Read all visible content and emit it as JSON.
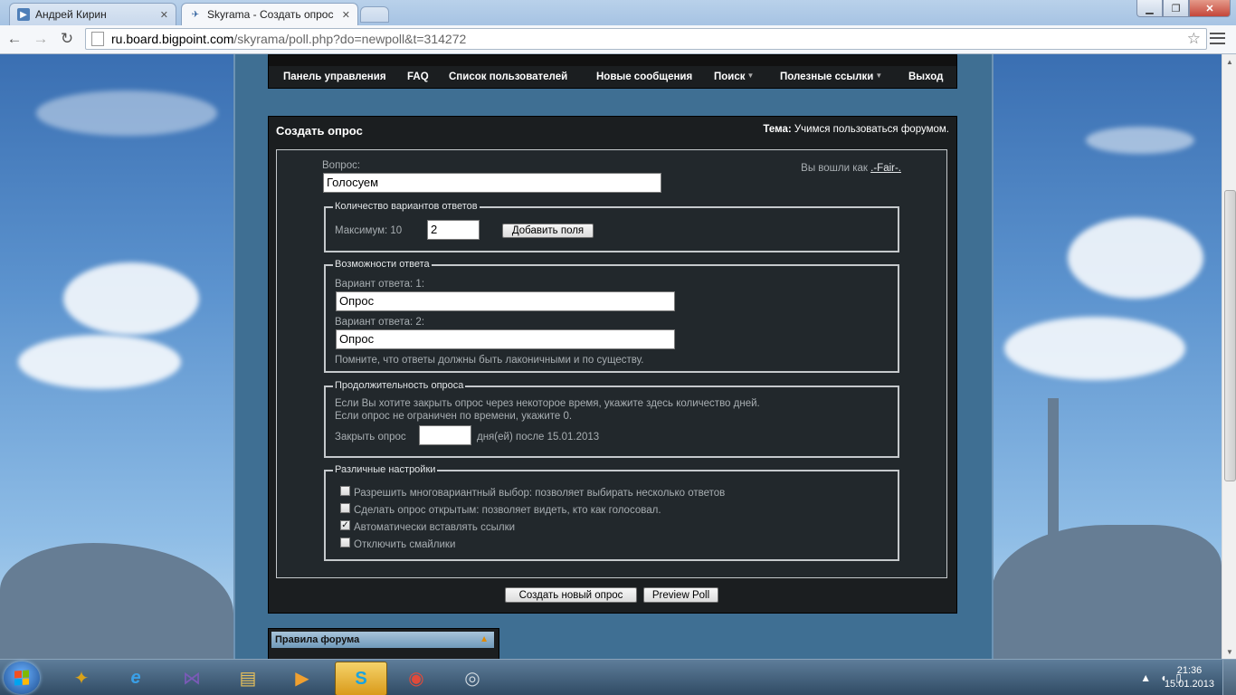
{
  "browser": {
    "tabs": [
      {
        "label": "Андрей Кирин"
      },
      {
        "label": "Skyrama - Создать опрос"
      }
    ],
    "url_host": "ru.board.bigpoint.com",
    "url_path": "/skyrama/poll.php?do=newpoll&t=314272"
  },
  "forum_nav": {
    "items": [
      {
        "label": "Панель управления"
      },
      {
        "label": "FAQ"
      },
      {
        "label": "Список пользователей"
      },
      {
        "label": "Новые сообщения"
      },
      {
        "label": "Поиск"
      },
      {
        "label": "Полезные ссылки"
      },
      {
        "label": "Выход"
      }
    ]
  },
  "poll_form": {
    "title": "Создать опрос",
    "topic_label": "Тема:",
    "topic_value": "Учимся пользоваться форумом.",
    "logged_in_label": "Вы вошли как",
    "username": ".-Fair-.",
    "question_label": "Вопрос:",
    "question_value": "Голосуем",
    "count_section": {
      "legend": "Количество вариантов ответов",
      "max_label": "Максимум: 10",
      "count_value": "2",
      "add_fields_label": "Добавить поля"
    },
    "options_section": {
      "legend": "Возможности ответа",
      "options": [
        {
          "label": "Вариант ответа: 1:",
          "value": "Опрос"
        },
        {
          "label": "Вариант ответа: 2:",
          "value": "Опрос"
        }
      ],
      "note": "Помните, что ответы должны быть лаконичными и по существу."
    },
    "duration_section": {
      "legend": "Продолжительность опроса",
      "line1": "Если Вы хотите закрыть опрос через некоторое время, укажите здесь количество дней.",
      "line2": "Если опрос не ограничен по времени, укажите 0.",
      "close_label": "Закрыть опрос",
      "days_value": "",
      "after_label": "дня(ей) после 15.01.2013"
    },
    "settings_section": {
      "legend": "Различные настройки",
      "options": [
        {
          "label": "Разрешить многовариантный выбор: позволяет выбирать несколько ответов",
          "checked": false
        },
        {
          "label": "Сделать опрос открытым: позволяет видеть, кто как голосовал.",
          "checked": false
        },
        {
          "label": "Автоматически вставлять ссылки",
          "checked": true
        },
        {
          "label": "Отключить смайлики",
          "checked": false
        }
      ]
    },
    "submit_label": "Создать новый опрос",
    "preview_label": "Preview Poll"
  },
  "rules_box": {
    "title": "Правила форума"
  },
  "taskbar": {
    "time": "21:36",
    "date": "15.01.2013"
  },
  "colors": {
    "panel_bg": "#1b1e20",
    "form_bg": "#22282c",
    "column_bg": "#3f6f93",
    "taskbar_active": "#e7b63a"
  }
}
